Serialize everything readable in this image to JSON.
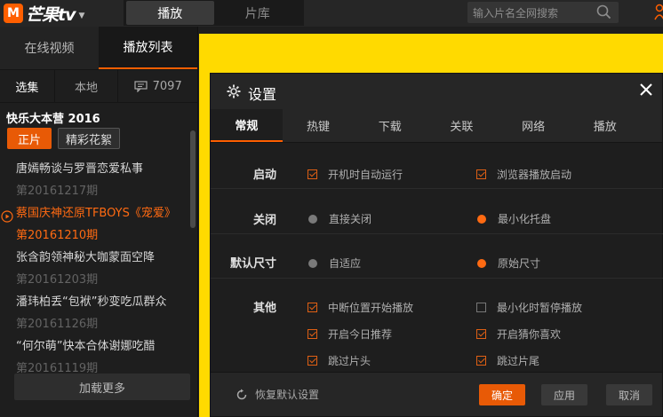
{
  "app": {
    "logo_text": "芒果tv",
    "logo_badge": "M"
  },
  "top_tabs": [
    {
      "label": "播放"
    },
    {
      "label": "片库"
    }
  ],
  "search": {
    "placeholder": "输入片名全网搜索"
  },
  "sidebar": {
    "tabs": [
      {
        "label": "在线视频"
      },
      {
        "label": "播放列表"
      }
    ],
    "sub_tabs": [
      {
        "label": "选集"
      },
      {
        "label": "本地"
      }
    ],
    "comment_count": "7097",
    "show_title": "快乐大本营 2016",
    "chips": [
      {
        "label": "正片"
      },
      {
        "label": "精彩花絮"
      }
    ],
    "episodes": [
      {
        "title": "唐嫣畅谈与罗晋恋爱私事",
        "date": "第20161217期"
      },
      {
        "title": "蔡国庆神还原TFBOYS《宠爱》",
        "date": "第20161210期"
      },
      {
        "title": "张含韵领神秘大咖蒙面空降",
        "date": "第20161203期"
      },
      {
        "title": "潘玮柏丢“包袱”秒变吃瓜群众",
        "date": "第20161126期"
      },
      {
        "title": "“何尔萌”快本合体谢娜吃醋",
        "date": "第20161119期"
      }
    ],
    "load_more": "加载更多"
  },
  "dialog": {
    "title": "设置",
    "tabs": [
      {
        "label": "常规"
      },
      {
        "label": "热键"
      },
      {
        "label": "下载"
      },
      {
        "label": "关联"
      },
      {
        "label": "网络"
      },
      {
        "label": "播放"
      }
    ],
    "rows": {
      "startup": {
        "label": "启动",
        "opt1": "开机时自动运行",
        "opt2": "浏览器播放启动"
      },
      "close": {
        "label": "关闭",
        "opt1": "直接关闭",
        "opt2": "最小化托盘"
      },
      "size": {
        "label": "默认尺寸",
        "opt1": "自适应",
        "opt2": "原始尺寸"
      },
      "other": {
        "label": "其他",
        "opts": [
          "中断位置开始播放",
          "最小化时暂停播放",
          "开启今日推荐",
          "开启猜你喜欢",
          "跳过片头",
          "跳过片尾"
        ]
      }
    },
    "reset": "恢复默认设置",
    "ok": "确定",
    "apply": "应用",
    "cancel": "取消"
  },
  "colors": {
    "accent": "#ff5f00",
    "video_bg": "#ffda00"
  }
}
